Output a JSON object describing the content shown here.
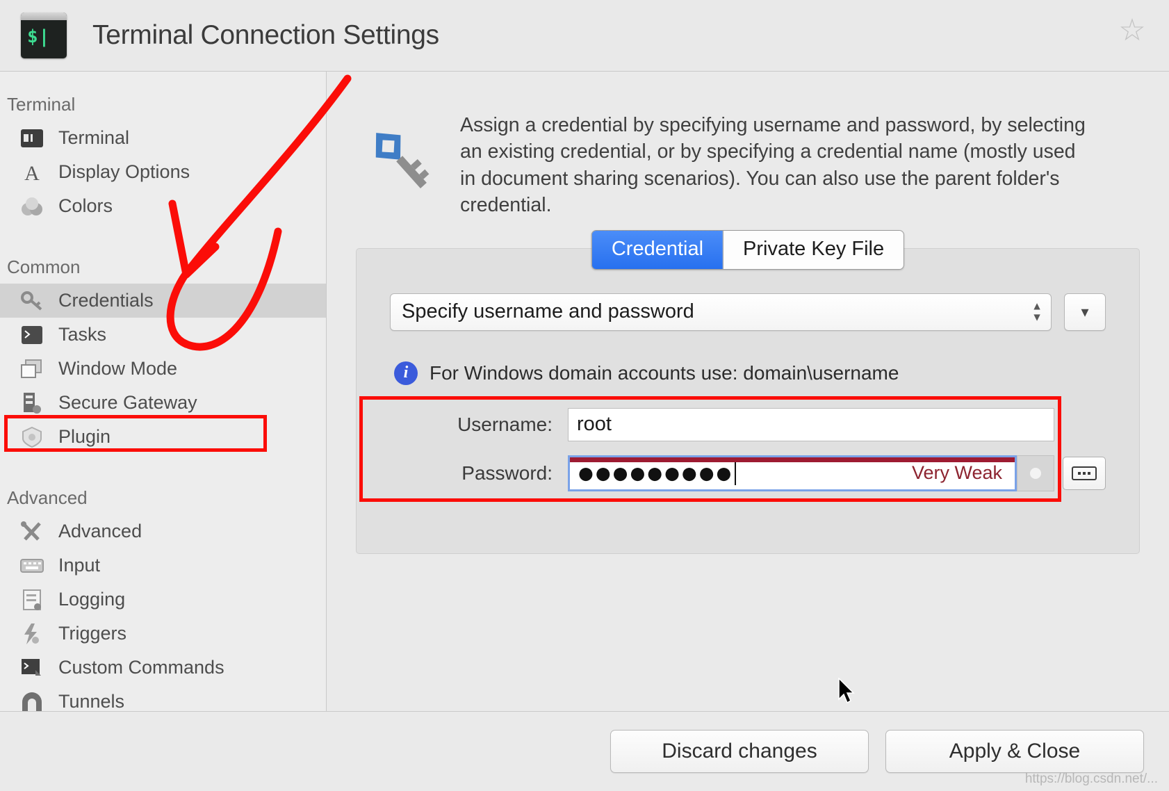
{
  "window": {
    "title": "Terminal Connection Settings",
    "app_icon": "terminal-icon",
    "prompt_glyph": "$|",
    "favorite_icon": "star-outline-icon"
  },
  "sidebar": {
    "groups": [
      {
        "title": "Terminal",
        "items": [
          {
            "label": "Terminal",
            "icon": "terminal-window-icon",
            "selected": false
          },
          {
            "label": "Display Options",
            "icon": "letter-a-icon",
            "selected": false
          },
          {
            "label": "Colors",
            "icon": "color-blobs-icon",
            "selected": false
          }
        ]
      },
      {
        "title": "Common",
        "items": [
          {
            "label": "Credentials",
            "icon": "key-icon",
            "selected": true
          },
          {
            "label": "Tasks",
            "icon": "console-icon",
            "selected": false
          },
          {
            "label": "Window Mode",
            "icon": "windows-icon",
            "selected": false
          },
          {
            "label": "Secure Gateway",
            "icon": "server-lock-icon",
            "selected": false
          },
          {
            "label": "Plugin",
            "icon": "shield-plugin-icon",
            "selected": false
          }
        ]
      },
      {
        "title": "Advanced",
        "items": [
          {
            "label": "Advanced",
            "icon": "tools-icon",
            "selected": false
          },
          {
            "label": "Input",
            "icon": "keyboard-icon",
            "selected": false
          },
          {
            "label": "Logging",
            "icon": "document-log-icon",
            "selected": false
          },
          {
            "label": "Triggers",
            "icon": "lightning-icon",
            "selected": false
          },
          {
            "label": "Custom Commands",
            "icon": "command-flag-icon",
            "selected": false
          },
          {
            "label": "Tunnels",
            "icon": "tunnel-icon",
            "selected": false
          }
        ]
      }
    ]
  },
  "main": {
    "description_icon": "blue-key-icon",
    "description": "Assign a credential by specifying username and password, by selecting an existing credential, or by specifying a credential name (mostly used in document sharing scenarios). You can also use the parent folder's credential.",
    "tabs": [
      {
        "label": "Credential",
        "active": true
      },
      {
        "label": "Private Key File",
        "active": false
      }
    ],
    "credential_mode": {
      "selected": "Specify username and password",
      "options": [
        "Specify username and password"
      ],
      "stepper_icon": "stepper-up-down-icon",
      "menu_button_icon": "chevron-down-icon"
    },
    "info": {
      "icon": "info-icon",
      "text": "For Windows domain accounts use: domain\\username"
    },
    "fields": {
      "username": {
        "label": "Username:",
        "value": "root",
        "placeholder": ""
      },
      "password": {
        "label": "Password:",
        "value": "●●●●●●●●●",
        "strength": "Very Weak",
        "strength_color": "#8d2430",
        "strength_bar_color": "#9e1b32",
        "toggle_icon": "dot-toggle-icon",
        "keyboard_icon": "virtual-keyboard-icon"
      }
    }
  },
  "footer": {
    "discard_label": "Discard changes",
    "apply_label": "Apply & Close"
  },
  "annotations": {
    "color": "#fb0d08",
    "arrow": "hand-drawn-arrow-to-credentials",
    "boxes": [
      "credentials-sidebar-item",
      "username-password-fields"
    ]
  },
  "watermark": "https://blog.csdn.net/..."
}
